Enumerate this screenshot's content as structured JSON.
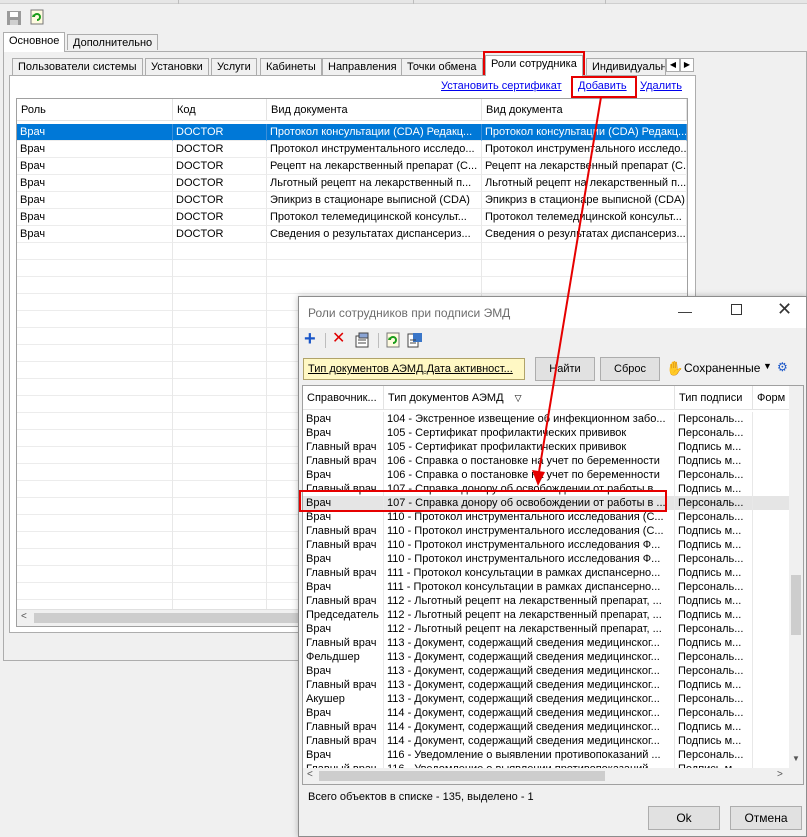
{
  "toolbar": {
    "icons": [
      "save-icon",
      "refresh-icon"
    ]
  },
  "main_tabs": [
    "Основное",
    "Дополнительно"
  ],
  "sub_tabs": [
    "Пользователи системы",
    "Установки",
    "Услуги",
    "Кабинеты",
    "Направления",
    "Точки обмена",
    "Роли сотрудника",
    "Индивидуальн"
  ],
  "actions": {
    "install_cert": "Установить сертификат",
    "add": "Добавить",
    "delete": "Удалить"
  },
  "roles_table": {
    "headers": [
      "Роль",
      "Код",
      "Вид документа",
      "Вид документа"
    ],
    "rows": [
      [
        "Врач",
        "DOCTOR",
        "Протокол консультации (CDA) Редакц...",
        "Протокол консультации (CDA) Редакц..."
      ],
      [
        "Врач",
        "DOCTOR",
        "Протокол инструментального исследо...",
        "Протокол инструментального исследо..."
      ],
      [
        "Врач",
        "DOCTOR",
        "Рецепт на лекарственный препарат (С...",
        "Рецепт на лекарственный препарат (С..."
      ],
      [
        "Врач",
        "DOCTOR",
        "Льготный рецепт на лекарственный п...",
        "Льготный рецепт на лекарственный п..."
      ],
      [
        "Врач",
        "DOCTOR",
        "Эпикриз в стационаре выписной (CDA)",
        "Эпикриз в стационаре выписной (CDA)"
      ],
      [
        "Врач",
        "DOCTOR",
        "Протокол телемедицинской консульт...",
        "Протокол телемедицинской консульт..."
      ],
      [
        "Врач",
        "DOCTOR",
        "Сведения о результатах диспансериз...",
        "Сведения о результатах диспансериз..."
      ]
    ]
  },
  "dialog": {
    "title": "Роли сотрудников при подписи ЭМД",
    "toolbar_icons": [
      "add-icon",
      "delete-icon",
      "properties-icon",
      "refresh-icon",
      "export-icon"
    ],
    "filter_text": "Тип документов АЭМД.Дата активност...",
    "find_label": "Найти",
    "reset_label": "Сброс",
    "saved_label": "Сохраненные",
    "headers": [
      "Справочник...",
      "Тип документов АЭМД",
      "Тип подписи",
      "Форм"
    ],
    "rows": [
      [
        "Врач",
        "104 - Экстренное извещение об инфекционном забо...",
        "Персональ..."
      ],
      [
        "Врач",
        "105 - Сертификат профилактических прививок",
        "Персональ..."
      ],
      [
        "Главный врач",
        "105 - Сертификат профилактических прививок",
        "Подпись м..."
      ],
      [
        "Главный врач",
        "106 - Справка о постановке на учет по беременности",
        "Подпись м..."
      ],
      [
        "Врач",
        "106 - Справка о постановке на учет по беременности",
        "Персональ..."
      ],
      [
        "Главный врач",
        "107 - Справка донору об освобождении от работы в ...",
        "Подпись м..."
      ],
      [
        "Врач",
        "107 - Справка донору об освобождении от работы в ...",
        "Персональ..."
      ],
      [
        "Врач",
        "110 - Протокол инструментального исследования (С...",
        "Персональ..."
      ],
      [
        "Главный врач",
        "110 - Протокол инструментального исследования (С...",
        "Подпись м..."
      ],
      [
        "Главный врач",
        "110 - Протокол инструментального исследования Ф...",
        "Подпись м..."
      ],
      [
        "Врач",
        "110 - Протокол инструментального исследования Ф...",
        "Персональ..."
      ],
      [
        "Главный врач",
        "111 - Протокол консультации в рамках диспансерно...",
        "Подпись м..."
      ],
      [
        "Врач",
        "111 - Протокол консультации в рамках диспансерно...",
        "Персональ..."
      ],
      [
        "Главный врач",
        "112 - Льготный рецепт на лекарственный препарат, ...",
        "Подпись м..."
      ],
      [
        "Председатель",
        "112 - Льготный рецепт на лекарственный препарат, ...",
        "Подпись м..."
      ],
      [
        "Врач",
        "112 - Льготный рецепт на лекарственный препарат, ...",
        "Персональ..."
      ],
      [
        "Главный врач",
        "113 - Документ, содержащий сведения медицинског...",
        "Подпись м..."
      ],
      [
        "Фельдшер",
        "113 - Документ, содержащий сведения медицинског...",
        "Персональ..."
      ],
      [
        "Врач",
        "113 - Документ, содержащий сведения медицинског...",
        "Персональ..."
      ],
      [
        "Главный врач",
        "113 - Документ, содержащий сведения медицинског...",
        "Подпись м..."
      ],
      [
        "Акушер",
        "113 - Документ, содержащий сведения медицинског...",
        "Персональ..."
      ],
      [
        "Врач",
        "114 - Документ, содержащий сведения медицинског...",
        "Персональ..."
      ],
      [
        "Главный врач",
        "114 - Документ, содержащий сведения медицинског...",
        "Подпись м..."
      ],
      [
        "Главный врач",
        "114 - Документ, содержащий сведения медицинског...",
        "Подпись м..."
      ],
      [
        "Врач",
        "116 - Уведомление о выявлении противопоказаний ...",
        "Персональ..."
      ],
      [
        "Главный врач",
        "116 - Уведомление о выявлении противопоказаний ...",
        "Подпись м..."
      ]
    ],
    "status": "Всего объектов в списке - 135, выделено - 1",
    "ok_label": "Ok",
    "cancel_label": "Отмена"
  },
  "colors": {
    "selection": "#0078d7",
    "highlight": "#e60000",
    "link": "#0000ee"
  }
}
